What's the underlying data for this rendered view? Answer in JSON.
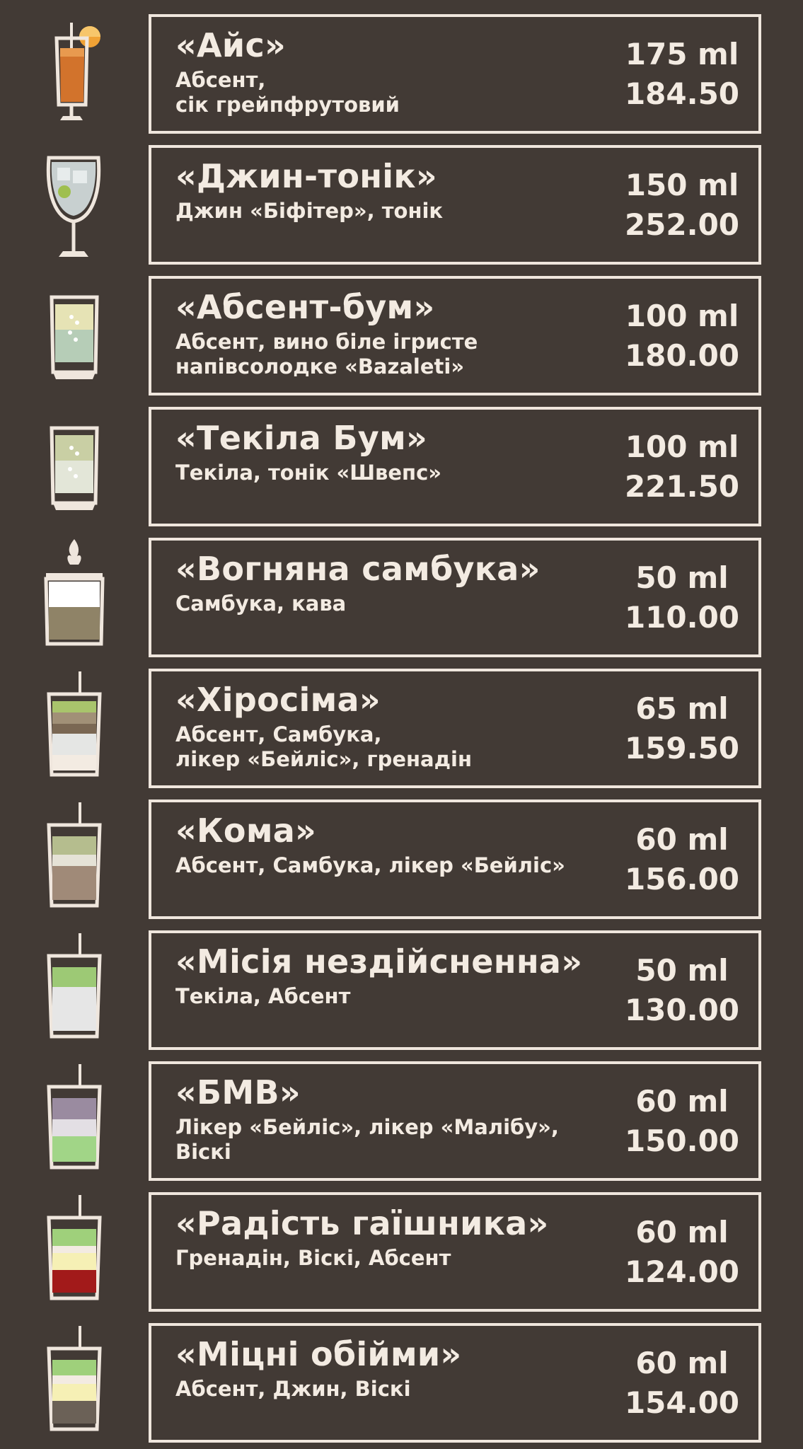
{
  "colors": {
    "background": "#423a35",
    "border": "#efe6dd",
    "text": "#f3ebe2"
  },
  "items": [
    {
      "icon": "highball-orange-cocktail-icon",
      "name": "«Айс»",
      "desc": "Абсент,\nсік грейпфрутовий",
      "volume": "175 ml",
      "price": "184.50"
    },
    {
      "icon": "gin-tonic-glass-icon",
      "name": "«Джин-тонік»",
      "desc": "Джин «Біфітер», тонік",
      "volume": "150 ml",
      "price": "252.00"
    },
    {
      "icon": "green-shot-glass-icon",
      "name": "«Абсент-бум»",
      "desc": "Абсент, вино біле ігристе\nнапівсолодке «Bazaleti»",
      "volume": "100 ml",
      "price": "180.00"
    },
    {
      "icon": "fizzy-shot-glass-icon",
      "name": "«Текіла Бум»",
      "desc": "Текіла, тонік «Швепс»",
      "volume": "100 ml",
      "price": "221.50"
    },
    {
      "icon": "flaming-shot-icon",
      "name": "«Вогняна самбука»",
      "desc": "Самбука, кава",
      "volume": "50 ml",
      "price": "110.00"
    },
    {
      "icon": "layered-shot-icon",
      "name": "«Хіросіма»",
      "desc": "Абсент, Самбука,\nлікер «Бейліс», гренадін",
      "volume": "65 ml",
      "price": "159.50"
    },
    {
      "icon": "layered-shot-icon",
      "name": "«Кома»",
      "desc": "Абсент, Самбука,  лікер «Бейліс»",
      "volume": "60 ml",
      "price": "156.00"
    },
    {
      "icon": "layered-shot-icon",
      "name": "«Місія нездійсненна»",
      "desc": "Текіла, Абсент",
      "volume": "50 ml",
      "price": "130.00"
    },
    {
      "icon": "layered-shot-icon",
      "name": "«БМВ»",
      "desc": "Лікер «Бейліс», лікер «Малібу»,\nВіскі",
      "volume": "60 ml",
      "price": "150.00"
    },
    {
      "icon": "layered-shot-icon",
      "name": "«Радість гаїшника»",
      "desc": "Гренадін, Віскі, Абсент",
      "volume": "60 ml",
      "price": "124.00"
    },
    {
      "icon": "layered-shot-icon",
      "name": "«Міцні обійми»",
      "desc": "Абсент, Джин, Віскі",
      "volume": "60 ml",
      "price": "154.00"
    }
  ]
}
